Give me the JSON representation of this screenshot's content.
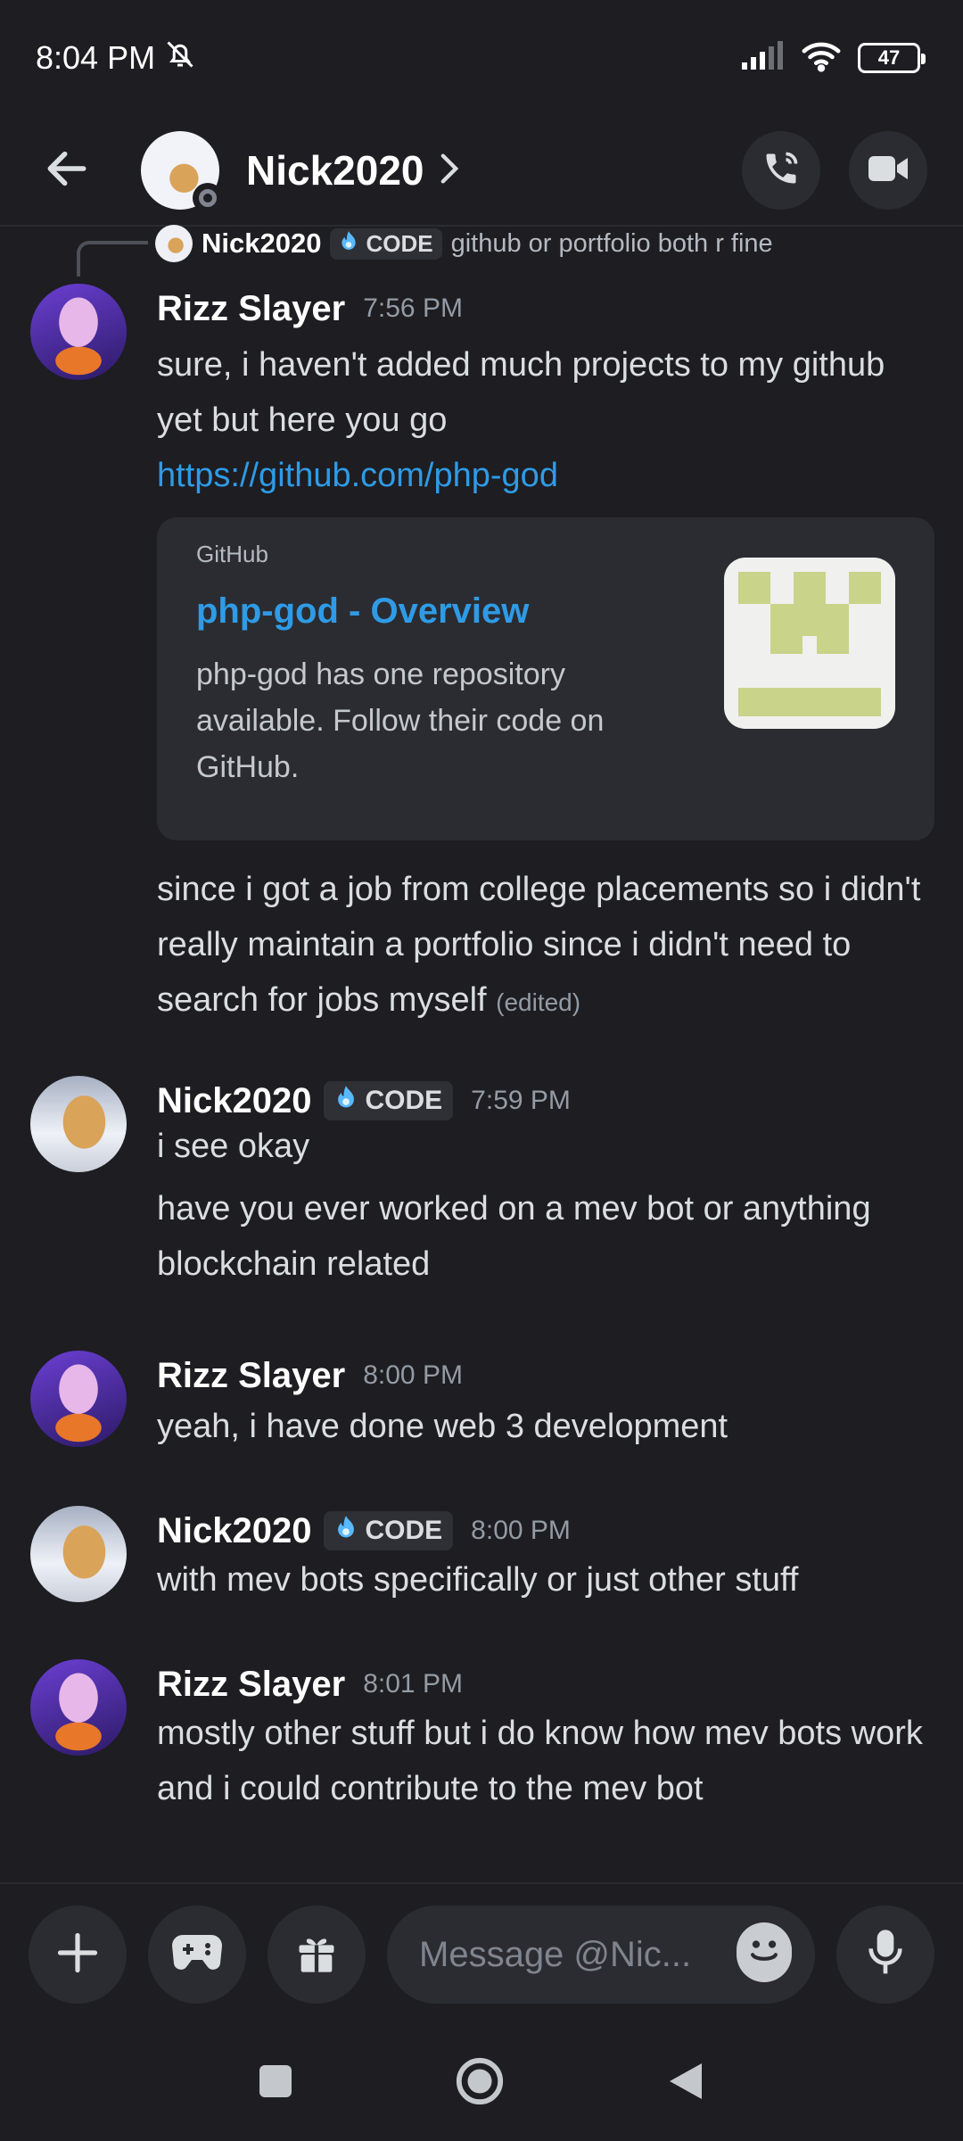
{
  "status_bar": {
    "time": "8:04 PM",
    "battery": "47",
    "icons": [
      "bell-off-icon",
      "signal-icon",
      "wifi-icon",
      "battery-icon"
    ]
  },
  "header": {
    "title": "Nick2020",
    "icons": [
      "back-arrow-icon",
      "chevron-right-icon",
      "phone-icon",
      "video-icon"
    ]
  },
  "reply_preview": {
    "author": "Nick2020",
    "tag": "CODE",
    "text": "github or portfolio both r fine"
  },
  "messages": [
    {
      "author": "Rizz Slayer",
      "time": "7:56 PM",
      "text": "sure, i haven't added much projects to my github yet but here you go",
      "link": "https://github.com/php-god",
      "embed": {
        "provider": "GitHub",
        "title": "php-god - Overview",
        "description": "php-god has one repository available. Follow their code on GitHub."
      },
      "followup": "since i got a job from college placements so i didn't really maintain a portfolio since i didn't need to search for jobs myself",
      "edited": "(edited)"
    },
    {
      "author": "Nick2020",
      "tag": "CODE",
      "time": "7:59 PM",
      "text": "i see okay",
      "followup": "have you ever worked on a mev bot or anything blockchain related"
    },
    {
      "author": "Rizz Slayer",
      "time": "8:00 PM",
      "text": "yeah, i have done web 3 development"
    },
    {
      "author": "Nick2020",
      "tag": "CODE",
      "time": "8:00 PM",
      "text": "with mev bots specifically or just other stuff"
    },
    {
      "author": "Rizz Slayer",
      "time": "8:01 PM",
      "text": "mostly other stuff but i do know how mev bots work and i could contribute to the mev bot"
    }
  ],
  "composer": {
    "placeholder": "Message @Nic...",
    "icons": [
      "plus-icon",
      "gamepad-icon",
      "gift-icon",
      "emoji-icon",
      "microphone-icon"
    ]
  },
  "colors": {
    "background": "#1d1d22",
    "link": "#2f9be6",
    "embed_bg": "#2b2c31",
    "thumb_accent": "#c9d48a"
  }
}
